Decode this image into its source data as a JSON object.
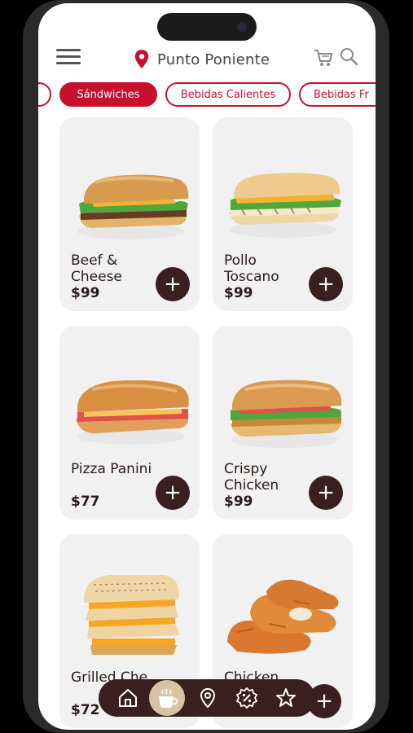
{
  "header": {
    "location": "Punto Poniente"
  },
  "categories": [
    {
      "label": ""
    },
    {
      "label": "Sándwiches"
    },
    {
      "label": "Bebidas Calientes"
    },
    {
      "label": "Bebidas Fr"
    }
  ],
  "products": [
    {
      "name": "Beef & Cheese",
      "price": "$99",
      "add_label": "+"
    },
    {
      "name": "Pollo Toscano",
      "price": "$99",
      "add_label": "+"
    },
    {
      "name": "Pizza Panini",
      "price": "$77",
      "add_label": "+"
    },
    {
      "name": "Crispy Chicken",
      "price": "$99",
      "add_label": "+"
    },
    {
      "name": "Grilled Che",
      "price": "$72",
      "add_label": "+"
    },
    {
      "name": "Chicken",
      "price": "",
      "add_label": "+"
    }
  ],
  "bottom_nav": {
    "items": [
      "home-icon",
      "coffee-cup-icon",
      "location-pin-icon",
      "percent-discount-icon",
      "star-icon"
    ],
    "add_label": "+"
  },
  "colors": {
    "brand_red": "#c8102e",
    "dark_brown": "#3a1f1f",
    "card_bg": "#f1f1f1",
    "cup_bg": "#d8c3a5"
  }
}
